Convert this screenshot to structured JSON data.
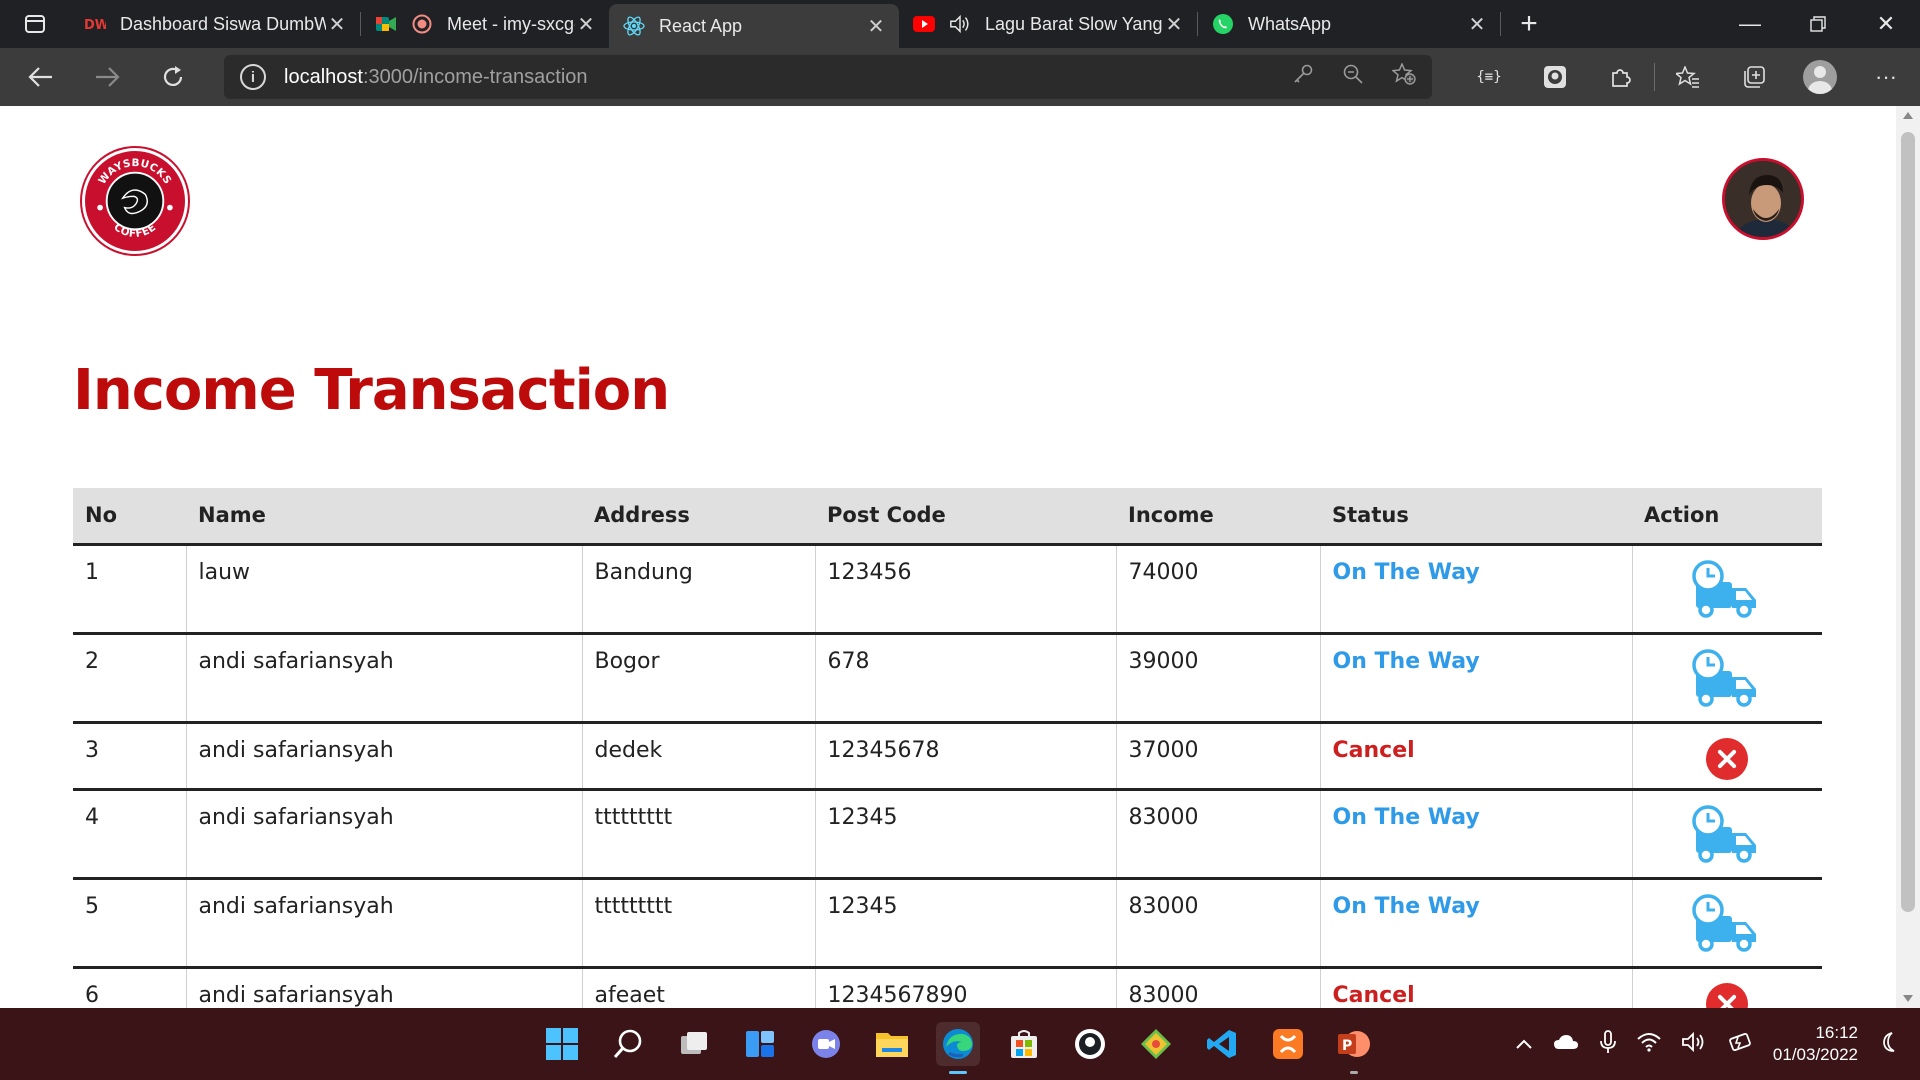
{
  "browser": {
    "tabs": [
      {
        "title": "Dashboard Siswa DumbW",
        "icon": "dumbways-icon",
        "active": false
      },
      {
        "title": "Meet - imy-sxcg-ung",
        "icon": "google-meet-icon",
        "active": false
      },
      {
        "title": "React App",
        "icon": "react-icon",
        "active": true
      },
      {
        "title": "Lagu Barat Slow Yang",
        "icon": "youtube-icon",
        "active": false
      },
      {
        "title": "WhatsApp",
        "icon": "whatsapp-icon",
        "active": false
      }
    ],
    "url_host": "localhost",
    "url_path": ":3000/income-transaction"
  },
  "page": {
    "logo_text_top": "WAYSBUCKS",
    "logo_text_bottom": "COFFEE",
    "title": "Income Transaction"
  },
  "table": {
    "headers": [
      "No",
      "Name",
      "Address",
      "Post Code",
      "Income",
      "Status",
      "Action"
    ],
    "rows": [
      {
        "no": "1",
        "name": "lauw",
        "address": "Bandung",
        "postcode": "123456",
        "income": "74000",
        "status": "On The Way",
        "action": "truck-icon"
      },
      {
        "no": "2",
        "name": "andi safariansyah",
        "address": "Bogor",
        "postcode": "678",
        "income": "39000",
        "status": "On The Way",
        "action": "truck-icon"
      },
      {
        "no": "3",
        "name": "andi safariansyah",
        "address": "dedek",
        "postcode": "12345678",
        "income": "37000",
        "status": "Cancel",
        "action": "cancel-icon"
      },
      {
        "no": "4",
        "name": "andi safariansyah",
        "address": "ttttttttt",
        "postcode": "12345",
        "income": "83000",
        "status": "On The Way",
        "action": "truck-icon"
      },
      {
        "no": "5",
        "name": "andi safariansyah",
        "address": "ttttttttt",
        "postcode": "12345",
        "income": "83000",
        "status": "On The Way",
        "action": "truck-icon"
      },
      {
        "no": "6",
        "name": "andi safariansyah",
        "address": "afeaet",
        "postcode": "1234567890",
        "income": "83000",
        "status": "Cancel",
        "action": "cancel-icon"
      }
    ]
  },
  "taskbar": {
    "time": "16:12",
    "date": "01/03/2022"
  },
  "colors": {
    "title_red": "#bd0a0a",
    "status_blue": "#2f9be8",
    "status_red": "#cc1f1f",
    "taskbar_bg": "#3a1416"
  }
}
